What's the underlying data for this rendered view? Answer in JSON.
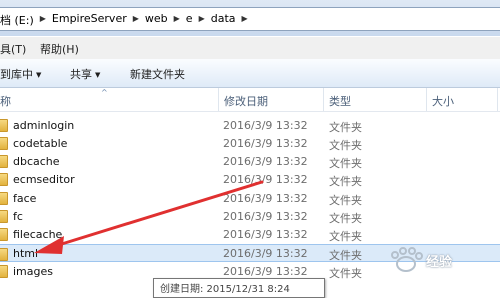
{
  "address_bar": {
    "crumbs": [
      "档 (E:)",
      "EmpireServer",
      "web",
      "e",
      "data"
    ]
  },
  "menu": {
    "items": [
      "具(T)",
      "帮助(H)"
    ]
  },
  "toolbar": {
    "include_library": "到库中",
    "share": "共享",
    "new_folder": "新建文件夹"
  },
  "columns": {
    "name": "称",
    "modified": "修改日期",
    "type": "类型",
    "size": "大小"
  },
  "files": [
    {
      "name": "adminlogin",
      "modified": "2016/3/9 13:32",
      "type": "文件夹"
    },
    {
      "name": "codetable",
      "modified": "2016/3/9 13:32",
      "type": "文件夹"
    },
    {
      "name": "dbcache",
      "modified": "2016/3/9 13:32",
      "type": "文件夹"
    },
    {
      "name": "ecmseditor",
      "modified": "2016/3/9 13:32",
      "type": "文件夹"
    },
    {
      "name": "face",
      "modified": "2016/3/9 13:32",
      "type": "文件夹"
    },
    {
      "name": "fc",
      "modified": "2016/3/9 13:32",
      "type": "文件夹"
    },
    {
      "name": "filecache",
      "modified": "2016/3/9 13:32",
      "type": "文件夹"
    },
    {
      "name": "html",
      "modified": "2016/3/9 13:32",
      "type": "文件夹",
      "selected": true
    },
    {
      "name": "images",
      "modified": "2016/3/9 13:32",
      "type": "文件夹"
    }
  ],
  "tooltip": {
    "text": "创建日期: 2015/12/31 8:24"
  },
  "watermark": {
    "text": "经验"
  },
  "colors": {
    "selection": "#dbeaf9",
    "arrow": "#e03030",
    "header_text": "#4c607a"
  }
}
